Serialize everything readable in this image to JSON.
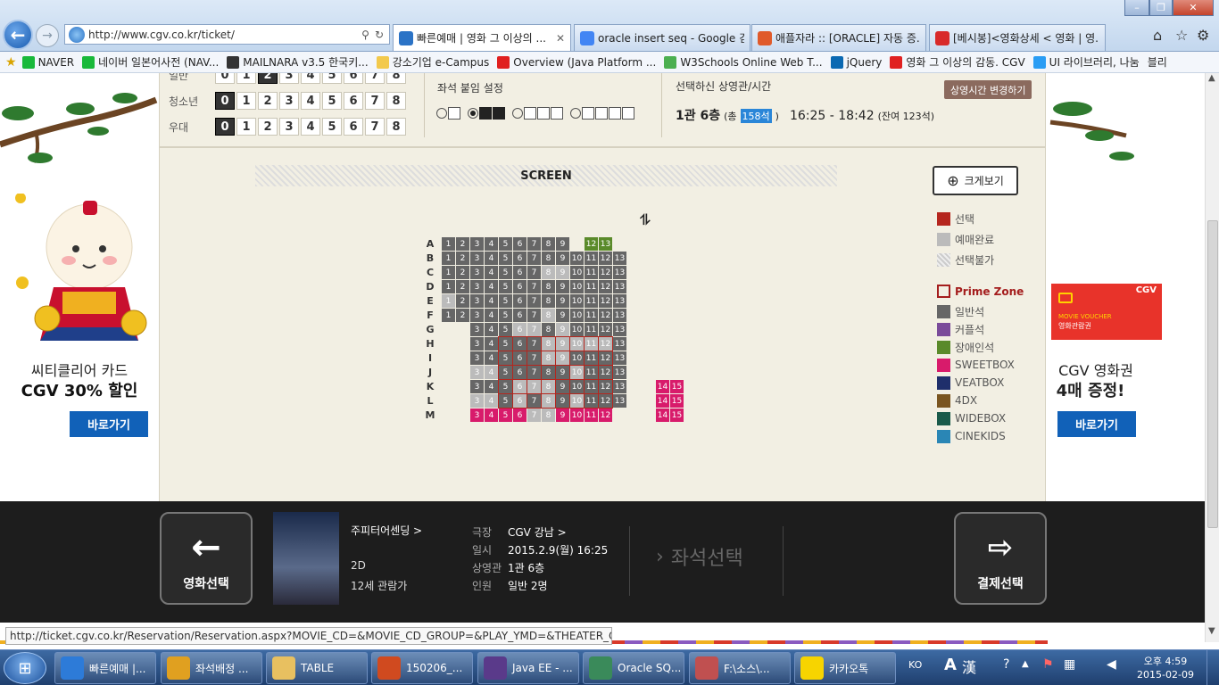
{
  "browser": {
    "url": "http://www.cgv.co.kr/ticket/",
    "tabs": [
      {
        "label": "빠른예매 | 영화 그 이상의 ...",
        "active": true,
        "icon": "ie-icon"
      },
      {
        "label": "oracle insert seq - Google 검색",
        "active": false,
        "icon": "google-icon"
      },
      {
        "label": "애플자라 :: [ORACLE] 자동 증...",
        "active": false,
        "icon": "tistory-icon"
      },
      {
        "label": "[베시봉]<영화상세 < 영화 | 영...",
        "active": false,
        "icon": "cgv-icon"
      }
    ],
    "favorites": [
      {
        "label": "NAVER",
        "icon": "naver-icon",
        "color": "#19b93a"
      },
      {
        "label": "네이버 일본어사전 (NAV...",
        "icon": "naver-icon",
        "color": "#19b93a"
      },
      {
        "label": "MAILNARA v3.5  한국키...",
        "icon": "mail-icon",
        "color": "#333333"
      },
      {
        "label": "강소기업 e-Campus",
        "icon": "doc-icon",
        "color": "#f2c94c"
      },
      {
        "label": "Overview (Java Platform ...",
        "icon": "oracle-icon",
        "color": "#e02020"
      },
      {
        "label": "W3Schools Online Web T...",
        "icon": "w3-icon",
        "color": "#4caf50"
      },
      {
        "label": "jQuery",
        "icon": "jquery-icon",
        "color": "#0b69b2"
      },
      {
        "label": "영화 그 이상의 감동. CGV",
        "icon": "cgv-icon",
        "color": "#e02020"
      },
      {
        "label": "UI 라이브러리, 나눔",
        "icon": "v-icon",
        "color": "#2a9df4"
      },
      {
        "label": "블리",
        "icon": "",
        "color": "#888888"
      }
    ],
    "status_url": "http://ticket.cgv.co.kr/Reservation/Reservation.aspx?MOVIE_CD=&MOVIE_CD_GROUP=&PLAY_YMD=&THEATER_CD=&PL..."
  },
  "people": {
    "rows": [
      {
        "label": "일반",
        "selected": 2
      },
      {
        "label": "청소년",
        "selected": 0
      },
      {
        "label": "우대",
        "selected": 0
      }
    ],
    "digits": [
      "0",
      "1",
      "2",
      "3",
      "4",
      "5",
      "6",
      "7",
      "8"
    ]
  },
  "seat_setting": {
    "title": "좌석 붙임 설정"
  },
  "selected_info": {
    "title": "선택하신 상영관/시간",
    "hall": "1관 6층",
    "total_prefix": "(총",
    "total": "158석",
    "total_suffix": ")",
    "time": "16:25 - 18:42",
    "remain": "(잔여 123석)",
    "change_btn": "상영시간 변경하기"
  },
  "screen_label": "SCREEN",
  "zoom_btn": "크게보기",
  "legend": {
    "status": [
      {
        "label": "선택",
        "color": "#b5261e"
      },
      {
        "label": "예매완료",
        "color": "#bbbbbb"
      },
      {
        "label": "선택불가",
        "color": "#d0d0d0"
      }
    ],
    "prime_zone": "Prime Zone",
    "types": [
      {
        "label": "일반석",
        "color": "#666666"
      },
      {
        "label": "커플석",
        "color": "#7a4b9a"
      },
      {
        "label": "장애인석",
        "color": "#5a8a2a"
      },
      {
        "label": "SWEETBOX",
        "color": "#d81b6b"
      },
      {
        "label": "VEATBOX",
        "color": "#1f2f6b"
      },
      {
        "label": "4DX",
        "color": "#7a5520"
      },
      {
        "label": "WIDEBOX",
        "color": "#1a5a4a"
      },
      {
        "label": "CINEKIDS",
        "color": "#2a86b5"
      }
    ]
  },
  "colors": {
    "normal": "#666666",
    "sold": "#bbbbbb",
    "disabled": "#bbbbbb",
    "accessible": "#5a8a2a",
    "sweet": "#d81b6b",
    "prime": "#b5261e"
  },
  "seat_rows": [
    {
      "r": "A",
      "seats": [
        [
          "1",
          "n"
        ],
        [
          "2",
          "n"
        ],
        [
          "3",
          "n"
        ],
        [
          "4",
          "n"
        ],
        [
          "5",
          "n"
        ],
        [
          "6",
          "n"
        ],
        [
          "7",
          "n"
        ],
        [
          "8",
          "n"
        ],
        [
          "9",
          "n"
        ],
        null,
        [
          "12",
          "a"
        ],
        [
          "13",
          "a"
        ]
      ]
    },
    {
      "r": "B",
      "seats": [
        [
          "1",
          "n"
        ],
        [
          "2",
          "n"
        ],
        [
          "3",
          "n"
        ],
        [
          "4",
          "n"
        ],
        [
          "5",
          "n"
        ],
        [
          "6",
          "n"
        ],
        [
          "7",
          "n"
        ],
        [
          "8",
          "n"
        ],
        [
          "9",
          "n"
        ],
        [
          "10",
          "n"
        ],
        [
          "11",
          "n"
        ],
        [
          "12",
          "n"
        ],
        [
          "13",
          "n"
        ]
      ]
    },
    {
      "r": "C",
      "seats": [
        [
          "1",
          "n"
        ],
        [
          "2",
          "n"
        ],
        [
          "3",
          "n"
        ],
        [
          "4",
          "n"
        ],
        [
          "5",
          "n"
        ],
        [
          "6",
          "n"
        ],
        [
          "7",
          "n"
        ],
        [
          "8",
          "s"
        ],
        [
          "9",
          "s"
        ],
        [
          "10",
          "n"
        ],
        [
          "11",
          "n"
        ],
        [
          "12",
          "n"
        ],
        [
          "13",
          "n"
        ]
      ]
    },
    {
      "r": "D",
      "seats": [
        [
          "1",
          "n"
        ],
        [
          "2",
          "n"
        ],
        [
          "3",
          "n"
        ],
        [
          "4",
          "n"
        ],
        [
          "5",
          "n"
        ],
        [
          "6",
          "n"
        ],
        [
          "7",
          "n"
        ],
        [
          "8",
          "n"
        ],
        [
          "9",
          "n"
        ],
        [
          "10",
          "n"
        ],
        [
          "11",
          "n"
        ],
        [
          "12",
          "n"
        ],
        [
          "13",
          "n"
        ]
      ]
    },
    {
      "r": "E",
      "seats": [
        [
          "1",
          "s"
        ],
        [
          "2",
          "n"
        ],
        [
          "3",
          "n"
        ],
        [
          "4",
          "n"
        ],
        [
          "5",
          "n"
        ],
        [
          "6",
          "n"
        ],
        [
          "7",
          "n"
        ],
        [
          "8",
          "n"
        ],
        [
          "9",
          "n"
        ],
        [
          "10",
          "n"
        ],
        [
          "11",
          "n"
        ],
        [
          "12",
          "n"
        ],
        [
          "13",
          "n"
        ]
      ]
    },
    {
      "r": "F",
      "seats": [
        [
          "1",
          "n"
        ],
        [
          "2",
          "n"
        ],
        [
          "3",
          "n"
        ],
        [
          "4",
          "n"
        ],
        [
          "5",
          "n"
        ],
        [
          "6",
          "n"
        ],
        [
          "7",
          "n"
        ],
        [
          "8",
          "s"
        ],
        [
          "9",
          "n"
        ],
        [
          "10",
          "n"
        ],
        [
          "11",
          "n"
        ],
        [
          "12",
          "n"
        ],
        [
          "13",
          "n"
        ]
      ]
    },
    {
      "r": "G",
      "seats": [
        null,
        null,
        [
          "3",
          "n"
        ],
        [
          "4",
          "n"
        ],
        [
          "5",
          "n"
        ],
        [
          "6",
          "s"
        ],
        [
          "7",
          "s"
        ],
        [
          "8",
          "n"
        ],
        [
          "9",
          "s"
        ],
        [
          "10",
          "n"
        ],
        [
          "11",
          "n"
        ],
        [
          "12",
          "n"
        ],
        [
          "13",
          "n"
        ]
      ]
    },
    {
      "r": "H",
      "seats": [
        null,
        null,
        [
          "3",
          "n"
        ],
        [
          "4",
          "n"
        ],
        [
          "5",
          "p"
        ],
        [
          "6",
          "p"
        ],
        [
          "7",
          "p"
        ],
        [
          "8",
          "ps"
        ],
        [
          "9",
          "ps"
        ],
        [
          "10",
          "ps"
        ],
        [
          "11",
          "ps"
        ],
        [
          "12",
          "ps"
        ],
        [
          "13",
          "n"
        ]
      ]
    },
    {
      "r": "I",
      "seats": [
        null,
        null,
        [
          "3",
          "n"
        ],
        [
          "4",
          "n"
        ],
        [
          "5",
          "p"
        ],
        [
          "6",
          "p"
        ],
        [
          "7",
          "p"
        ],
        [
          "8",
          "ps"
        ],
        [
          "9",
          "ps"
        ],
        [
          "10",
          "p"
        ],
        [
          "11",
          "p"
        ],
        [
          "12",
          "p"
        ],
        [
          "13",
          "n"
        ]
      ]
    },
    {
      "r": "J",
      "seats": [
        null,
        null,
        [
          "3",
          "s"
        ],
        [
          "4",
          "s"
        ],
        [
          "5",
          "p"
        ],
        [
          "6",
          "p"
        ],
        [
          "7",
          "p"
        ],
        [
          "8",
          "p"
        ],
        [
          "9",
          "p"
        ],
        [
          "10",
          "ps"
        ],
        [
          "11",
          "p"
        ],
        [
          "12",
          "p"
        ],
        [
          "13",
          "n"
        ]
      ]
    },
    {
      "r": "K",
      "seats": [
        null,
        null,
        [
          "3",
          "n"
        ],
        [
          "4",
          "n"
        ],
        [
          "5",
          "p"
        ],
        [
          "6",
          "ps"
        ],
        [
          "7",
          "ps"
        ],
        [
          "8",
          "ps"
        ],
        [
          "9",
          "p"
        ],
        [
          "10",
          "p"
        ],
        [
          "11",
          "p"
        ],
        [
          "12",
          "p"
        ],
        [
          "13",
          "n"
        ],
        null,
        null,
        [
          "14",
          "w"
        ],
        [
          "15",
          "w"
        ]
      ]
    },
    {
      "r": "L",
      "seats": [
        null,
        null,
        [
          "3",
          "s"
        ],
        [
          "4",
          "s"
        ],
        [
          "5",
          "p"
        ],
        [
          "6",
          "ps"
        ],
        [
          "7",
          "p"
        ],
        [
          "8",
          "ps"
        ],
        [
          "9",
          "p"
        ],
        [
          "10",
          "ps"
        ],
        [
          "11",
          "p"
        ],
        [
          "12",
          "p"
        ],
        [
          "13",
          "n"
        ],
        null,
        null,
        [
          "14",
          "w"
        ],
        [
          "15",
          "w"
        ]
      ]
    },
    {
      "r": "M",
      "seats": [
        null,
        null,
        [
          "3",
          "w"
        ],
        [
          "4",
          "w"
        ],
        [
          "5",
          "w"
        ],
        [
          "6",
          "w"
        ],
        [
          "7",
          "s"
        ],
        [
          "8",
          "s"
        ],
        [
          "9",
          "w"
        ],
        [
          "10",
          "w"
        ],
        [
          "11",
          "w"
        ],
        [
          "12",
          "w"
        ],
        null,
        null,
        null,
        [
          "14",
          "w"
        ],
        [
          "15",
          "w"
        ]
      ]
    }
  ],
  "ads": {
    "left": {
      "line1": "씨티클리어 카드",
      "line2": "CGV 30% 할인",
      "button": "바로가기"
    },
    "right": {
      "badge_top": "CGV",
      "voucher": "MOVIE VOUCHER",
      "voucher_sub": "영화관람권",
      "line1": "CGV 영화권",
      "line2": "4매 증정!",
      "button": "바로가기"
    }
  },
  "bottom": {
    "back_btn": "영화선택",
    "movie_title": "주피터어센딩 >",
    "format": "2D",
    "rating": "12세 관람가",
    "info": [
      {
        "k": "극장",
        "v": "CGV 강남 >"
      },
      {
        "k": "일시",
        "v": "2015.2.9(월) 16:25"
      },
      {
        "k": "상영관",
        "v": "1관 6층"
      },
      {
        "k": "인원",
        "v": "일반 2명"
      }
    ],
    "step": "좌석선택",
    "next_btn": "결제선택"
  },
  "taskbar": {
    "items": [
      {
        "label": "빠른예매 |...",
        "color": "#2d7bd8"
      },
      {
        "label": "좌석배정 ...",
        "color": "#e0a020"
      },
      {
        "label": "TABLE",
        "color": "#e8c060"
      },
      {
        "label": "150206_...",
        "color": "#d04a1f"
      },
      {
        "label": "Java EE - ...",
        "color": "#5a3a8a"
      },
      {
        "label": "Oracle SQ...",
        "color": "#3a8a5a"
      },
      {
        "label": "F:\\소스\\...",
        "color": "#c05050"
      },
      {
        "label": "카카오톡",
        "color": "#f7d400"
      }
    ],
    "lang": "KO",
    "ime1": "A",
    "ime2": "漢",
    "ampm": "오후 4:59",
    "date": "2015-02-09"
  }
}
